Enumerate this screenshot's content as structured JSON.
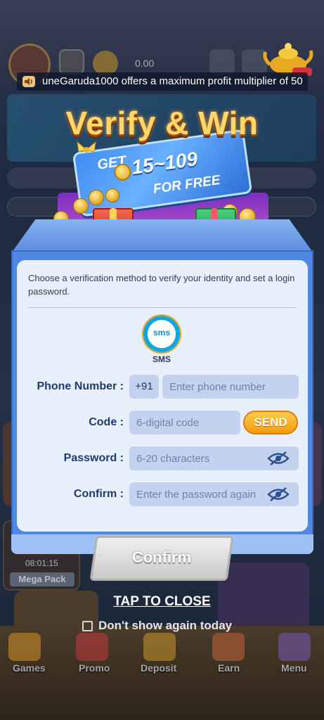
{
  "background": {
    "balance": "0.00",
    "mega_pack_timer": "08:01:15",
    "mega_pack_label": "Mega Pack",
    "bottom_nav": [
      {
        "label": "Games"
      },
      {
        "label": "Promo"
      },
      {
        "label": "Deposit"
      },
      {
        "label": "Earn"
      },
      {
        "label": "Menu"
      }
    ]
  },
  "ticker": {
    "text": "uneGaruda1000 offers a maximum profit multiplier of 50"
  },
  "popup": {
    "title": "Verify & Win",
    "ticket_get": "GET",
    "ticket_amount": "15~109",
    "ticket_free": "FOR FREE",
    "description": "Choose a verification method to verify your identity and set a login password.",
    "method_icon_text": "sms",
    "method_label": "SMS",
    "phone": {
      "label": "Phone Number :",
      "prefix": "+91",
      "placeholder": "Enter phone number"
    },
    "code": {
      "label": "Code :",
      "placeholder": "6-digital code",
      "send_label": "SEND"
    },
    "password": {
      "label": "Password :",
      "placeholder": "6-20 characters"
    },
    "confirm_password": {
      "label": "Confirm :",
      "placeholder": "Enter the password again"
    },
    "confirm_button": "Confirm",
    "tap_to_close": "TAP TO CLOSE",
    "dont_show": "Don't show again today"
  },
  "colors": {
    "title_gold": "#ffd76a",
    "dialog_blue": "#4f87e4",
    "panel_bg": "#e8f0fc",
    "send_orange": "#f39c12"
  }
}
